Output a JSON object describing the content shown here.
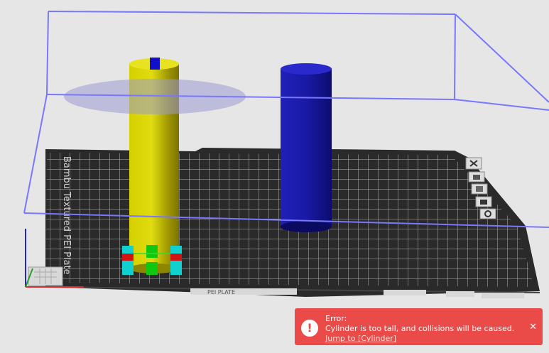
{
  "plate": {
    "name_label": "Bambu Textured PEI Plate",
    "bottom_label": "PEI PLATE"
  },
  "objects": {
    "yellow": {
      "name": "Cylinder",
      "color": "#c8c000"
    },
    "blue": {
      "color": "#1d1d9a"
    }
  },
  "build_volume_color": "#7878ff",
  "plate_icons": [
    "close-icon",
    "lock-icon",
    "arrange-icon",
    "camera-icon",
    "settings-icon"
  ],
  "notification": {
    "type": "error",
    "color": "#ea4b49",
    "title": "Error:",
    "message": "Cylinder is too tall, and collisions will be caused.",
    "link": "Jump to [Cylinder]",
    "close": "✕"
  }
}
